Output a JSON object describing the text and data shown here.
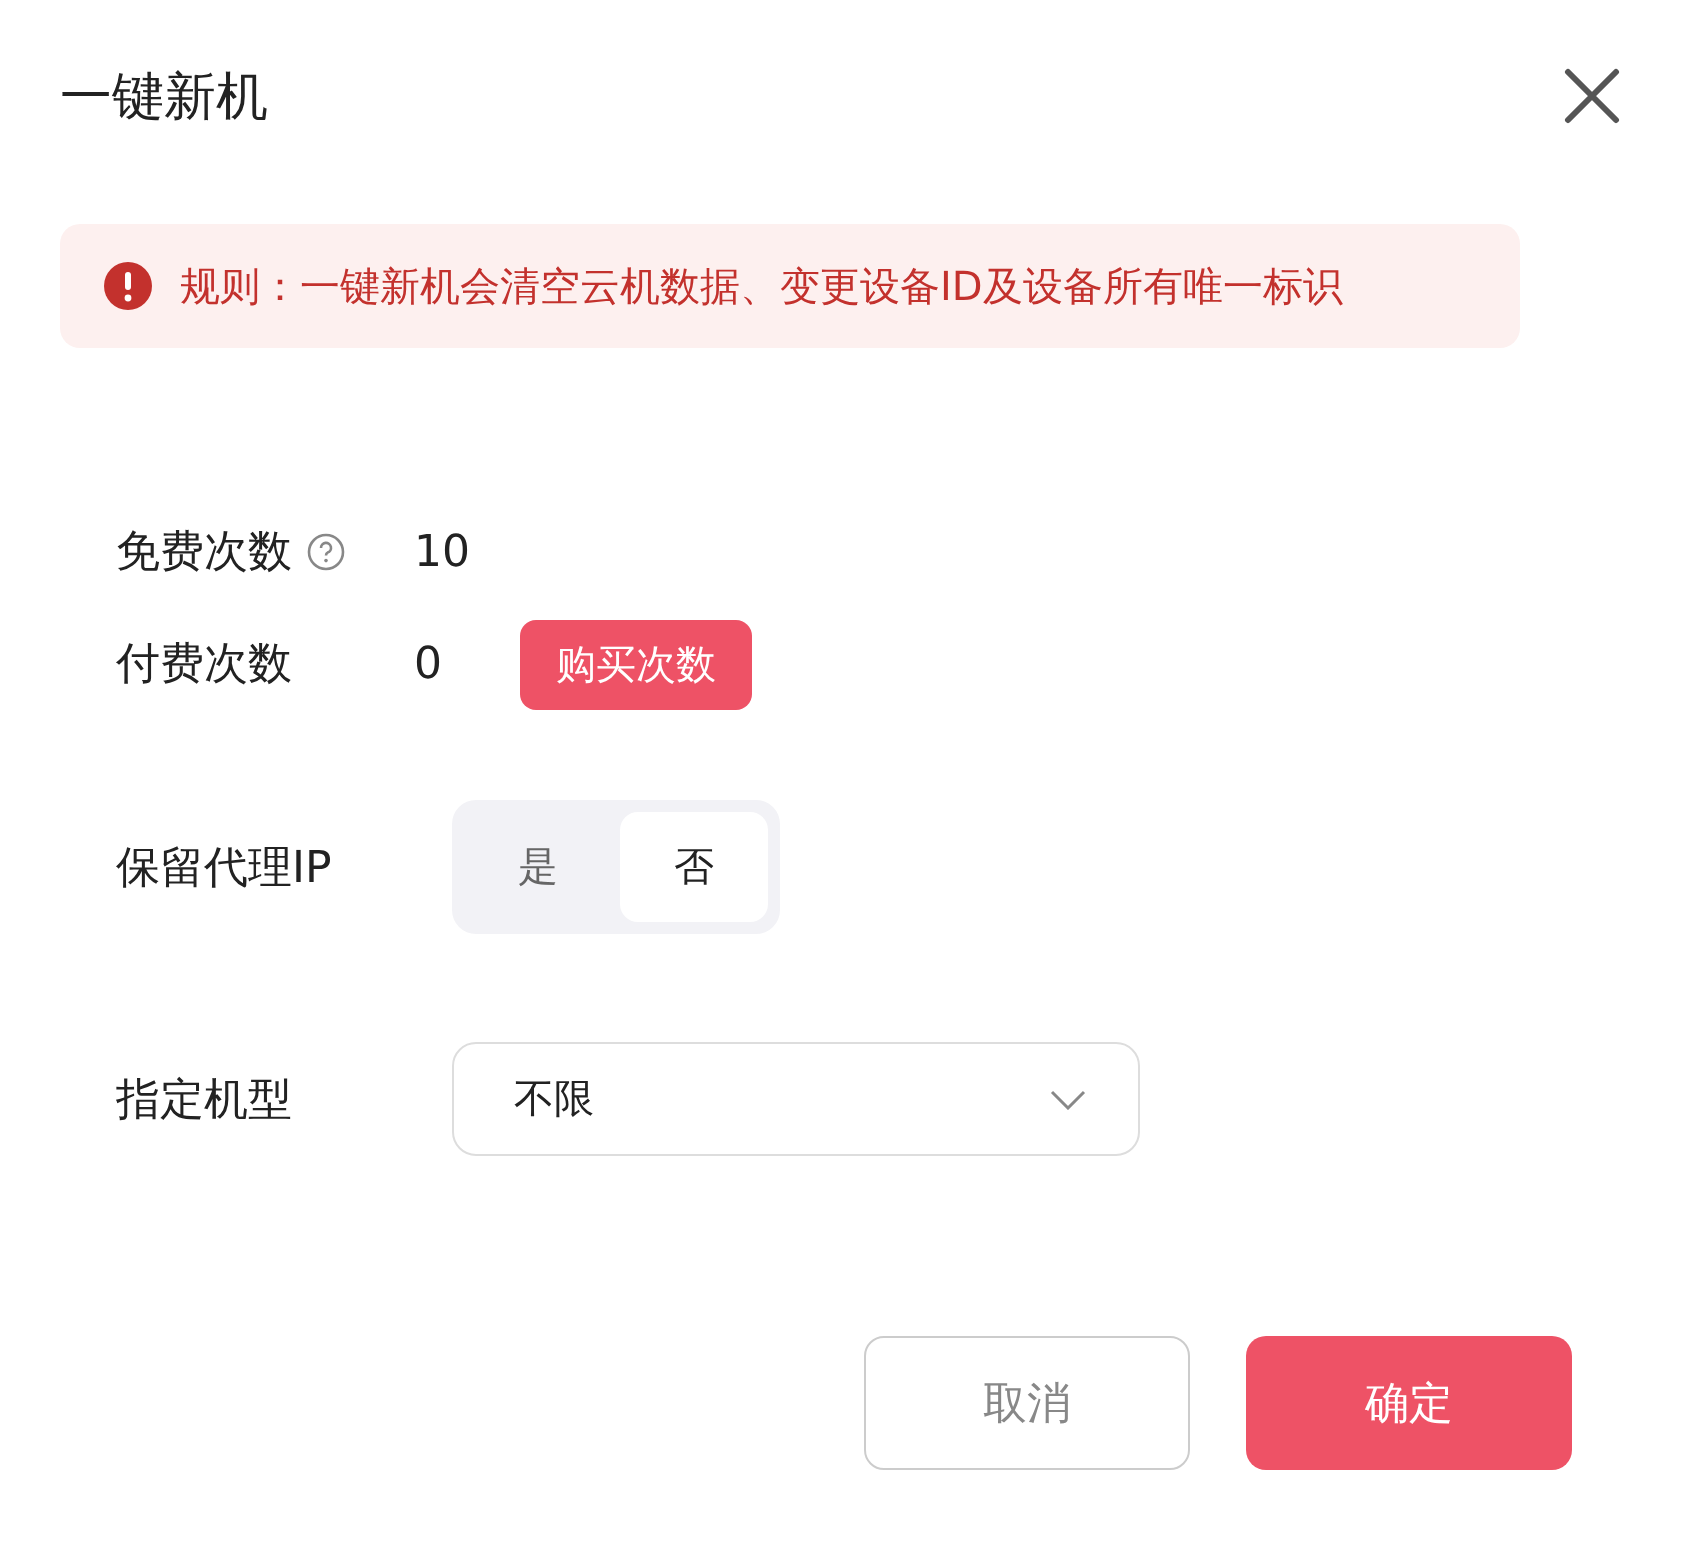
{
  "dialog": {
    "title": "一键新机"
  },
  "alert": {
    "text": "规则：一键新机会清空云机数据、变更设备ID及设备所有唯一标识"
  },
  "fields": [
    {
      "kind": "count",
      "label": "免费次数",
      "help": true,
      "value": "10"
    },
    {
      "kind": "count",
      "label": "付费次数",
      "help": false,
      "value": "0",
      "action": "购买次数"
    },
    {
      "kind": "toggle",
      "label": "保留代理IP",
      "options": [
        {
          "label": "是",
          "selected": false
        },
        {
          "label": "否",
          "selected": true
        }
      ]
    },
    {
      "kind": "select",
      "label": "指定机型",
      "value": "不限"
    }
  ],
  "buttons": [
    {
      "label": "取消",
      "kind": "secondary"
    },
    {
      "label": "确定",
      "kind": "primary"
    }
  ]
}
